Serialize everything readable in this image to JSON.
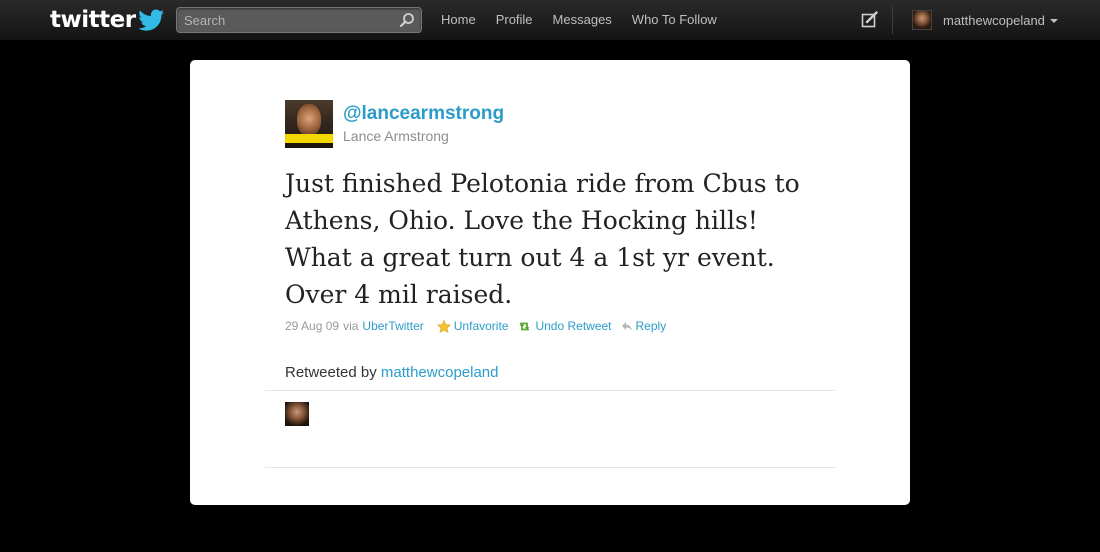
{
  "topbar": {
    "logo_text": "twitter",
    "search": {
      "placeholder": "Search",
      "value": ""
    },
    "nav": [
      {
        "label": "Home"
      },
      {
        "label": "Profile"
      },
      {
        "label": "Messages"
      },
      {
        "label": "Who To Follow"
      }
    ],
    "user": {
      "name": "matthewcopeland"
    }
  },
  "tweet": {
    "screen_name": "@lancearmstrong",
    "full_name": "Lance Armstrong",
    "lines": [
      "Just finished Pelotonia ride from Cbus to",
      "Athens, Ohio. Love the Hocking hills!",
      "What a great turn out 4 a 1st yr event.",
      "Over 4 mil raised."
    ],
    "date": "29 Aug 09",
    "via_label": "via",
    "source": "UberTwitter",
    "actions": {
      "unfavorite": "Unfavorite",
      "undo_retweet": "Undo Retweet",
      "reply": "Reply"
    },
    "retweeted_by_label": "Retweeted by",
    "retweeted_by_user": "matthewcopeland"
  },
  "colors": {
    "link": "#2b9cc9",
    "topbar": "#1e1e1e",
    "background": "#000000",
    "favorite_star": "#f2c230",
    "retweet_green": "#5ca832"
  }
}
